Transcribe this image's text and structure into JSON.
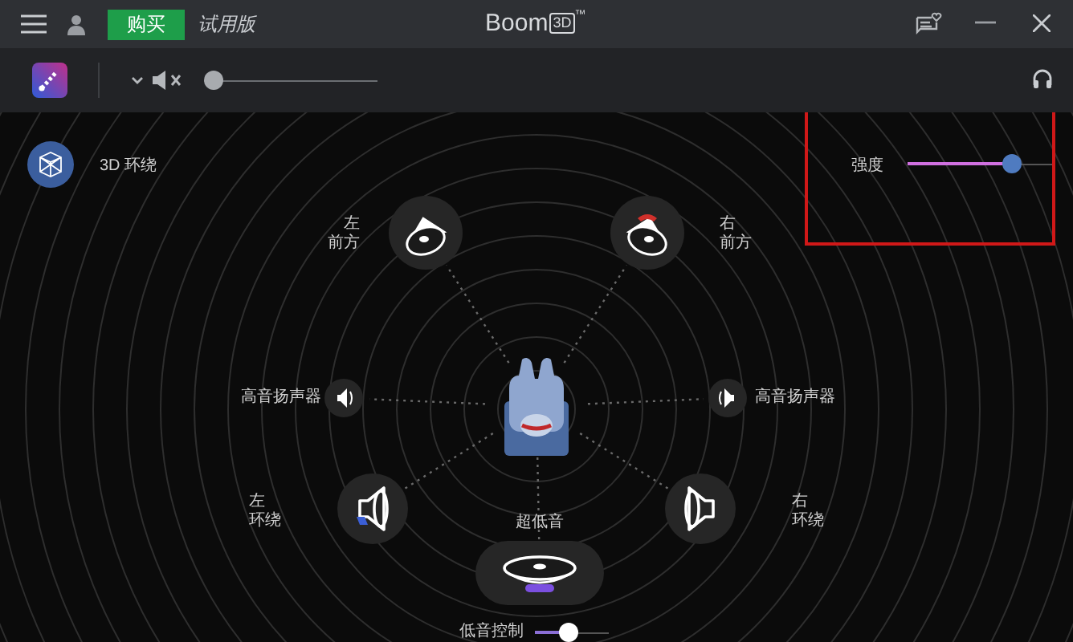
{
  "title_bar": {
    "buy_button": "购买",
    "trial_label": "试用版",
    "app_name": "Boom",
    "logo_mark": "3D",
    "trademark": "™"
  },
  "toolbar": {
    "muted": true,
    "volume": {
      "level": 0
    }
  },
  "effect": {
    "label": "3D 环绕",
    "strength_label": "强度",
    "strength": {
      "level": 0.75
    }
  },
  "speakers": [
    {
      "kind": "front",
      "label_lines": [
        "左",
        "前方"
      ]
    },
    {
      "kind": "front",
      "label_lines": [
        "右",
        "前方"
      ],
      "color": "#d0302b"
    },
    {
      "kind": "tweeter",
      "label_lines": [
        "高音扬声器"
      ]
    },
    {
      "kind": "tweeter",
      "label_lines": [
        "高音扬声器"
      ]
    },
    {
      "kind": "surround",
      "label_lines": [
        "左",
        "环绕"
      ],
      "color": "#3b5fd6"
    },
    {
      "kind": "subwoofer",
      "label_lines": [
        "超低音"
      ],
      "color": "#7b4fe0"
    },
    {
      "kind": "surround",
      "label_lines": [
        "右",
        "环绕"
      ]
    }
  ],
  "bass": {
    "label": "低音控制",
    "level": 0.45
  }
}
